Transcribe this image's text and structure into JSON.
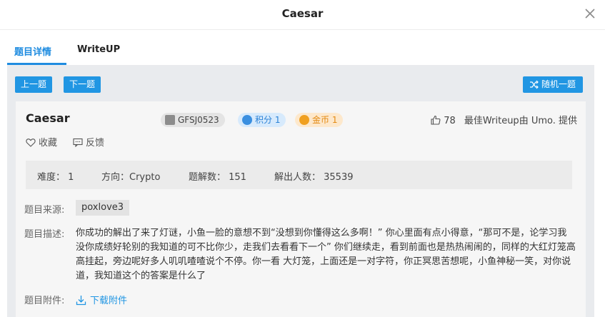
{
  "modal": {
    "title": "Caesar"
  },
  "tabs": [
    {
      "label": "题目详情"
    },
    {
      "label": "WriteUP"
    }
  ],
  "toolbar": {
    "prev_label": "上一题",
    "next_label": "下一题",
    "random_label": "随机一题"
  },
  "challenge": {
    "title": "Caesar",
    "tag_id": "GFSJ0523",
    "tag_score": "积分 1",
    "tag_coin": "金币 1",
    "likes": "78",
    "writeup_by": "最佳Writeup由 Umo. 提供",
    "favorite_label": "收藏",
    "feedback_label": "反馈"
  },
  "stats": {
    "difficulty": "难度：  1",
    "direction": "方向：Crypto",
    "solves": "题解数：  151",
    "solvers": "解出人数：  35539"
  },
  "details": {
    "source_label": "题目来源:",
    "source_value": "poxlove3",
    "desc_label": "题目描述:",
    "desc_text": "你成功的解出了来了灯谜，小鱼一脸的意想不到“没想到你懂得这么多啊！” 你心里面有点小得意，“那可不是，论学习我没你成绩好轮别的我知道的可不比你少，走我们去看看下一个” 你们继续走，看到前面也是热热闹闹的，同样的大红灯笼高高挂起，旁边呢好多人叽叽喳喳说个不停。你一看 大灯笼，上面还是一对字符，你正冥思苦想呢，小鱼神秘一笑，对你说道，我知道这个的答案是什么了",
    "attach_label": "题目附件:",
    "download_label": "下载附件"
  },
  "colors": {
    "accent": "#2196e3",
    "panel_bg": "#e9ebee",
    "score_tag": "#d7eafc",
    "coin_tag": "#fde8cc"
  }
}
